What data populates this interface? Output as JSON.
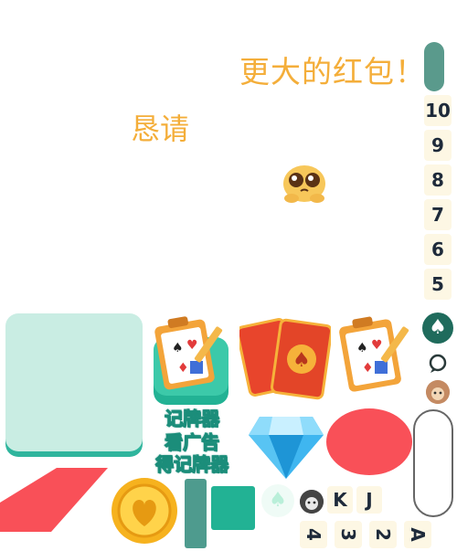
{
  "game": {
    "title": "更大的红包！",
    "plead": "恳请",
    "card_ranks": [
      "10",
      "9",
      "8",
      "7",
      "6",
      "5"
    ],
    "bottom_ranks_top": [
      "K",
      "J"
    ],
    "bottom_ranks_bottom": [
      "4",
      "3",
      "2",
      "A"
    ],
    "recorder_label_1": "记牌器",
    "recorder_label_2": "看广告",
    "recorder_label_3": "得记牌器",
    "spade_symbol": "♠",
    "chat_symbol": "◯"
  },
  "colors": {
    "title": "#f4ae3a",
    "teal": "#22b294",
    "panel": "#c9ede3",
    "red": "#f95058"
  }
}
